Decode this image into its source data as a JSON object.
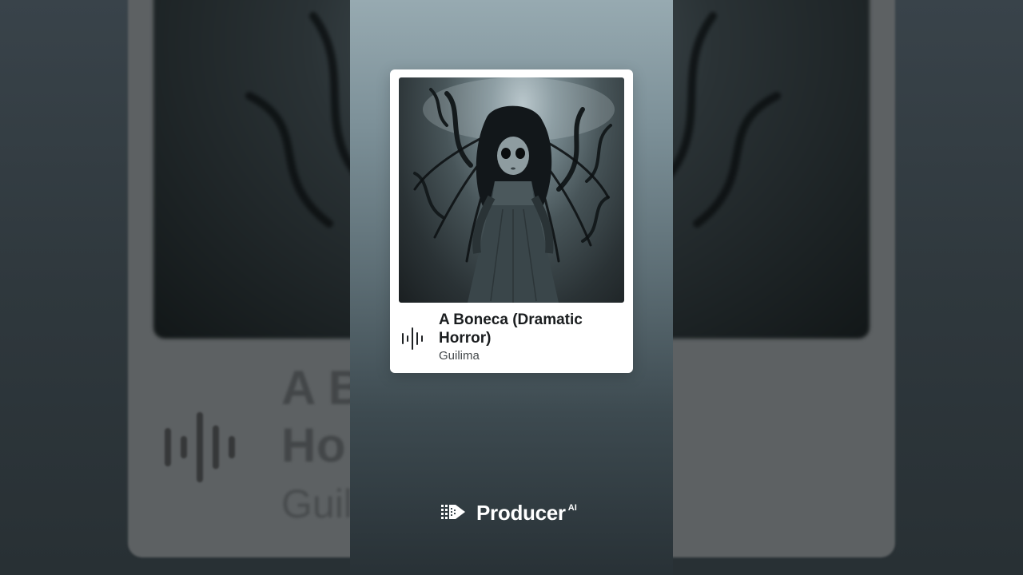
{
  "song": {
    "title": "A Boneca (Dramatic Horror)",
    "title_line1": "A Boneca (Dramatic",
    "title_line2": "Horror)",
    "artist": "Guilima"
  },
  "background": {
    "title_line1": "A B          atic",
    "title_line2": "Ho",
    "artist": "Guil"
  },
  "brand": {
    "name": "Producer",
    "superscript": "AI"
  },
  "icons": {
    "waveform": "audio-waveform-icon",
    "brand": "producer-logo-icon"
  },
  "colors": {
    "card": "#ffffff",
    "title_text": "#1a1d1f",
    "brand_text": "#ffffff",
    "gradient_top": "#97aab1",
    "gradient_bottom": "#283136"
  }
}
